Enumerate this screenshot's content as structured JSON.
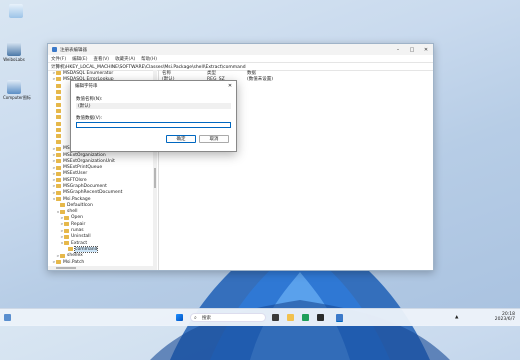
{
  "desktop": {
    "icons": [
      {
        "label": "",
        "icon": "recycle-bin-icon",
        "color": "#6fa9e0"
      },
      {
        "label": "WeiboLabs",
        "icon": "computer-icon",
        "color": "#4a78a8"
      },
      {
        "label": "Computer图标",
        "icon": "monitor-icon",
        "color": "#5b8ec5"
      }
    ]
  },
  "window": {
    "title": "注册表编辑器",
    "menu": [
      "文件(F)",
      "编辑(E)",
      "查看(V)",
      "收藏夹(A)",
      "帮助(H)"
    ],
    "address": "计算机\\HKEY_LOCAL_MACHINE\\SOFTWARE\\Classes\\Msi.Package\\shell\\Extract\\command",
    "tree": [
      {
        "label": "MSDASQL Enumerator",
        "indent": 1,
        "exp": ">"
      },
      {
        "label": "MSDASQL ErrorLookup",
        "indent": 1,
        "exp": ">"
      },
      {
        "label": "",
        "indent": 1,
        "exp": ""
      },
      {
        "label": "",
        "indent": 1,
        "exp": ""
      },
      {
        "label": "",
        "indent": 1,
        "exp": ""
      },
      {
        "label": "",
        "indent": 1,
        "exp": ""
      },
      {
        "label": "",
        "indent": 1,
        "exp": ""
      },
      {
        "label": "",
        "indent": 1,
        "exp": ""
      },
      {
        "label": "",
        "indent": 1,
        "exp": ""
      },
      {
        "label": "",
        "indent": 1,
        "exp": ""
      },
      {
        "label": "",
        "indent": 1,
        "exp": ""
      },
      {
        "label": "",
        "indent": 1,
        "exp": ""
      },
      {
        "label": "MSExtLocality",
        "indent": 1,
        "exp": ">"
      },
      {
        "label": "MSExtOrganization",
        "indent": 1,
        "exp": ">"
      },
      {
        "label": "MSExtOrganizationUnit",
        "indent": 1,
        "exp": ">"
      },
      {
        "label": "MSExtPrintQueue",
        "indent": 1,
        "exp": ">"
      },
      {
        "label": "MSExtUser",
        "indent": 1,
        "exp": ">"
      },
      {
        "label": "MSFTOlsre",
        "indent": 1,
        "exp": ">"
      },
      {
        "label": "MSGraphDocument",
        "indent": 1,
        "exp": ">"
      },
      {
        "label": "MSGraphRecentDocument",
        "indent": 1,
        "exp": ">"
      },
      {
        "label": "Msi.Package",
        "indent": 1,
        "exp": "v"
      },
      {
        "label": "DefaultIcon",
        "indent": 2,
        "exp": ""
      },
      {
        "label": "shell",
        "indent": 2,
        "exp": "v"
      },
      {
        "label": "Open",
        "indent": 3,
        "exp": ">"
      },
      {
        "label": "Repair",
        "indent": 3,
        "exp": ">"
      },
      {
        "label": "runas",
        "indent": 3,
        "exp": ">"
      },
      {
        "label": "Uninstall",
        "indent": 3,
        "exp": ">"
      },
      {
        "label": "Extract",
        "indent": 3,
        "exp": "v"
      },
      {
        "label": "command",
        "indent": 4,
        "exp": "",
        "selected": true
      },
      {
        "label": "shellex",
        "indent": 2,
        "exp": ">"
      },
      {
        "label": "Msi.Patch",
        "indent": 1,
        "exp": ">"
      }
    ],
    "list": {
      "headers": [
        "名称",
        "类型",
        "数据"
      ],
      "rows": [
        {
          "name": "(默认)",
          "type": "REG_SZ",
          "data": "(数值未设置)"
        }
      ]
    }
  },
  "dialog": {
    "title": "编辑字符串",
    "name_label": "数值名称(N):",
    "name_value": "(默认)",
    "data_label": "数值数据(V):",
    "data_value": "",
    "ok": "确定",
    "cancel": "取消"
  },
  "taskbar": {
    "search_placeholder": "搜索",
    "time": "20:18",
    "date": "2023/6/7"
  }
}
